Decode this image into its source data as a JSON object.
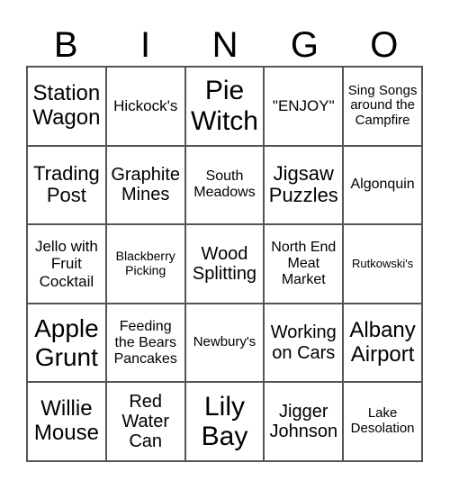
{
  "header": {
    "letters": [
      "B",
      "I",
      "N",
      "G",
      "O"
    ]
  },
  "cells": [
    "Station Wagon",
    "Hickock's",
    "Pie Witch",
    "\"ENJOY\"",
    "Sing Songs around the Campfire",
    "Trading Post",
    "Graphite Mines",
    "South Meadows",
    "Jigsaw Puzzles",
    "Algonquin",
    "Jello with Fruit Cocktail",
    "Blackberry Picking",
    "Wood Splitting",
    "North End Meat Market",
    "Rutkowski's",
    "Apple Grunt",
    "Feeding the Bears Pancakes",
    "Newbury's",
    "Working on Cars",
    "Albany Airport",
    "Willie Mouse",
    "Red Water Can",
    "Lily Bay",
    "Jigger Johnson",
    "Lake Desolation"
  ]
}
